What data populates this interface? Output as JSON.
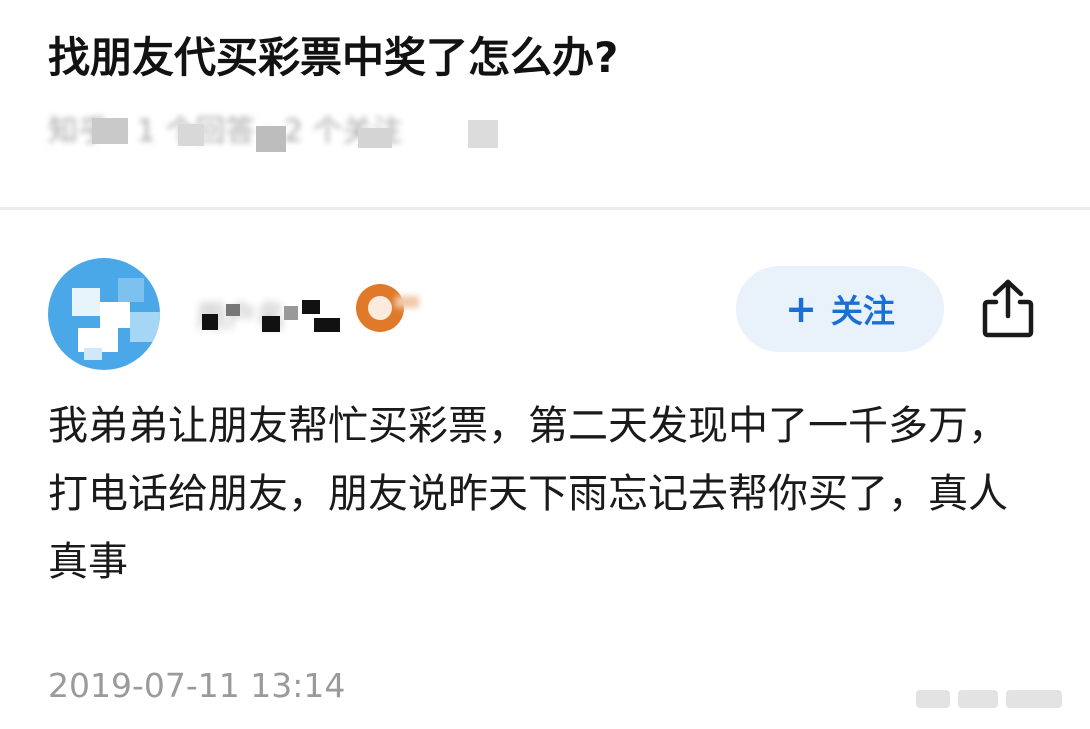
{
  "question": {
    "title": "找朋友代买彩票中奖了怎么办?",
    "meta": "知乎 · 1 个回答 · 2 个关注"
  },
  "author": {
    "name": "用户名",
    "avatar_color": "#4aa7e8",
    "badge_color": "#e07a2a"
  },
  "actions": {
    "follow_label": "关注",
    "follow_plus": "+",
    "follow_bg": "#e9f1fb",
    "follow_color": "#1a6fd6",
    "share_icon": "share-icon"
  },
  "answer": {
    "text": "我弟弟让朋友帮忙买彩票，第二天发现中了一千多万，打电话给朋友，朋友说昨天下雨忘记去帮你买了，真人真事",
    "timestamp": "2019-07-11 13:14"
  }
}
